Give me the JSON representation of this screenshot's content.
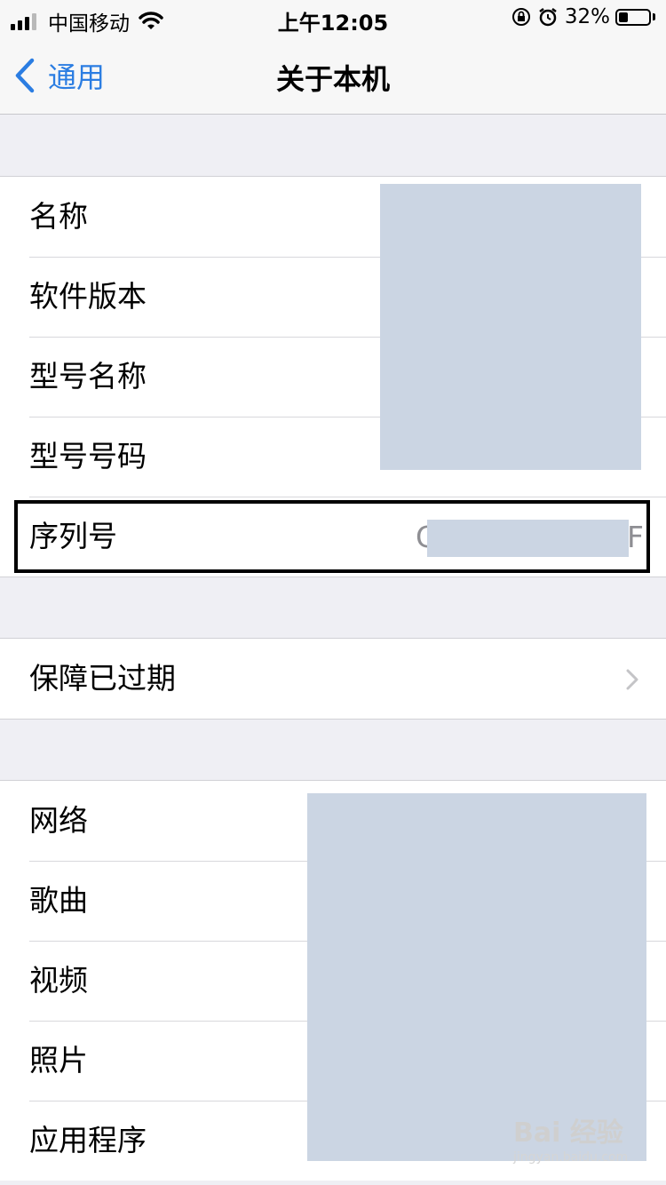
{
  "status_bar": {
    "carrier": "中国移动",
    "time": "上午12:05",
    "battery_percent": "32%",
    "battery_level": 0.32,
    "icons": [
      "signal-icon",
      "wifi-icon",
      "orientation-lock-icon",
      "alarm-icon",
      "battery-icon"
    ]
  },
  "nav": {
    "back_label": "通用",
    "title": "关于本机"
  },
  "group1": {
    "rows": [
      {
        "label": "名称"
      },
      {
        "label": "软件版本"
      },
      {
        "label": "型号名称"
      },
      {
        "label": "型号号码"
      },
      {
        "label": "序列号",
        "value_start": "C",
        "value_end": "F"
      }
    ]
  },
  "group2": {
    "rows": [
      {
        "label": "保障已过期"
      }
    ]
  },
  "group3": {
    "rows": [
      {
        "label": "网络"
      },
      {
        "label": "歌曲"
      },
      {
        "label": "视频"
      },
      {
        "label": "照片"
      },
      {
        "label": "应用程序"
      }
    ]
  },
  "watermark": {
    "brand": "Bai 经验",
    "url": "jingyan.baidu.com"
  },
  "colors": {
    "accent": "#2b7de2",
    "redaction": "#cbd5e3",
    "background": "#efeff4"
  }
}
